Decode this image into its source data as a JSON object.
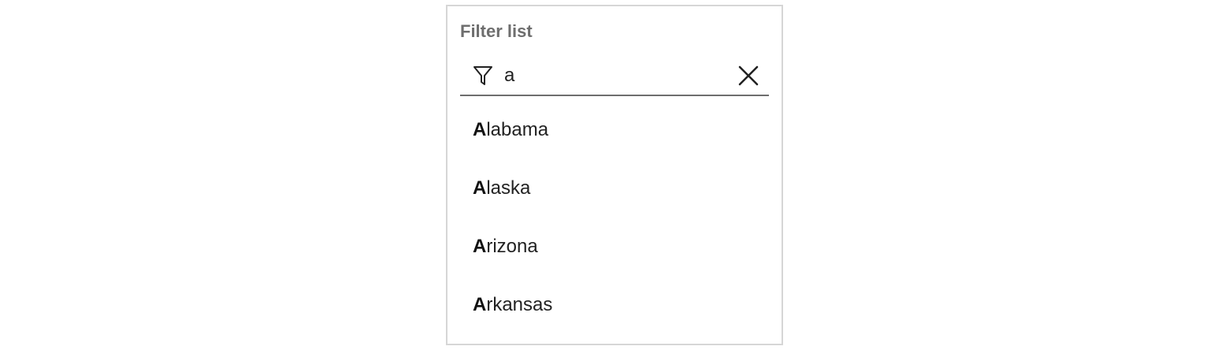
{
  "panel": {
    "label": "Filter list"
  },
  "search": {
    "value": "a",
    "icon": "filter-icon",
    "clear_icon": "close-icon"
  },
  "items": [
    {
      "match": "A",
      "rest": "labama"
    },
    {
      "match": "A",
      "rest": "laska"
    },
    {
      "match": "A",
      "rest": "rizona"
    },
    {
      "match": "A",
      "rest": "rkansas"
    }
  ],
  "colors": {
    "border": "#d6d6d6",
    "underline": "#6e6e6e",
    "label": "#6e6e6e",
    "text": "#222222"
  }
}
